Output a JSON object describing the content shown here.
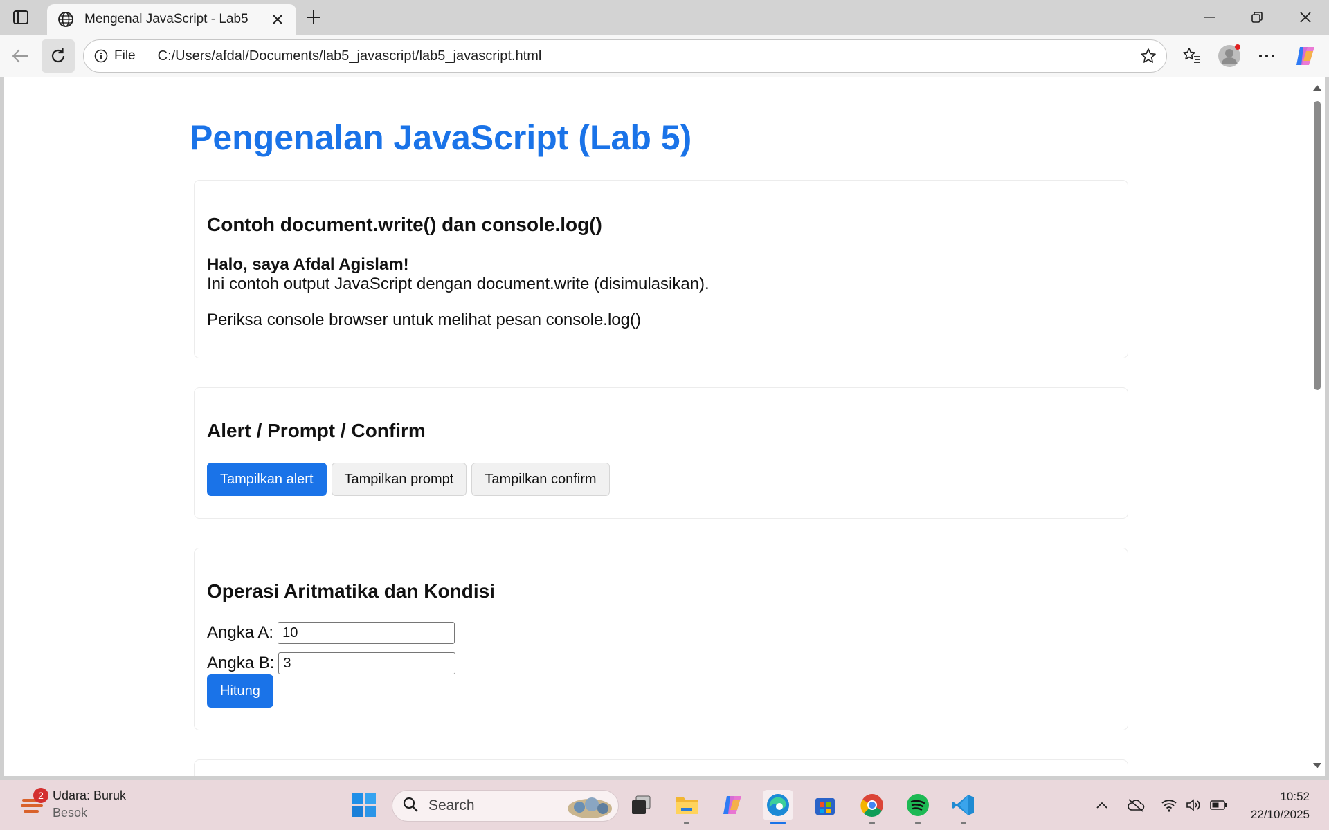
{
  "browser": {
    "tab_title": "Mengenal JavaScript - Lab5",
    "scheme_label": "File",
    "url": "C:/Users/afdal/Documents/lab5_javascript/lab5_javascript.html"
  },
  "page": {
    "title": "Pengenalan JavaScript (Lab 5)",
    "section1": {
      "heading": "Contoh document.write() dan console.log()",
      "greeting": "Halo, saya Afdal Agislam!",
      "write_line": "Ini contoh output JavaScript dengan document.write (disimulasikan).",
      "console_note": "Periksa console browser untuk melihat pesan console.log()"
    },
    "section2": {
      "heading": "Alert / Prompt / Confirm",
      "alert_label": "Tampilkan alert",
      "prompt_label": "Tampilkan prompt",
      "confirm_label": "Tampilkan confirm"
    },
    "section3": {
      "heading": "Operasi Aritmatika dan Kondisi",
      "label_a": "Angka A:",
      "value_a": "10",
      "label_b": "Angka B:",
      "value_b": "3",
      "button_label": "Hitung"
    }
  },
  "taskbar": {
    "weather_title": "Udara: Buruk",
    "weather_sub": "Besok",
    "weather_badge": "2",
    "search_placeholder": "Search",
    "time": "10:52",
    "date": "22/10/2025"
  },
  "colors": {
    "accent": "#1a73e8",
    "taskbar": "#ead8dc"
  }
}
